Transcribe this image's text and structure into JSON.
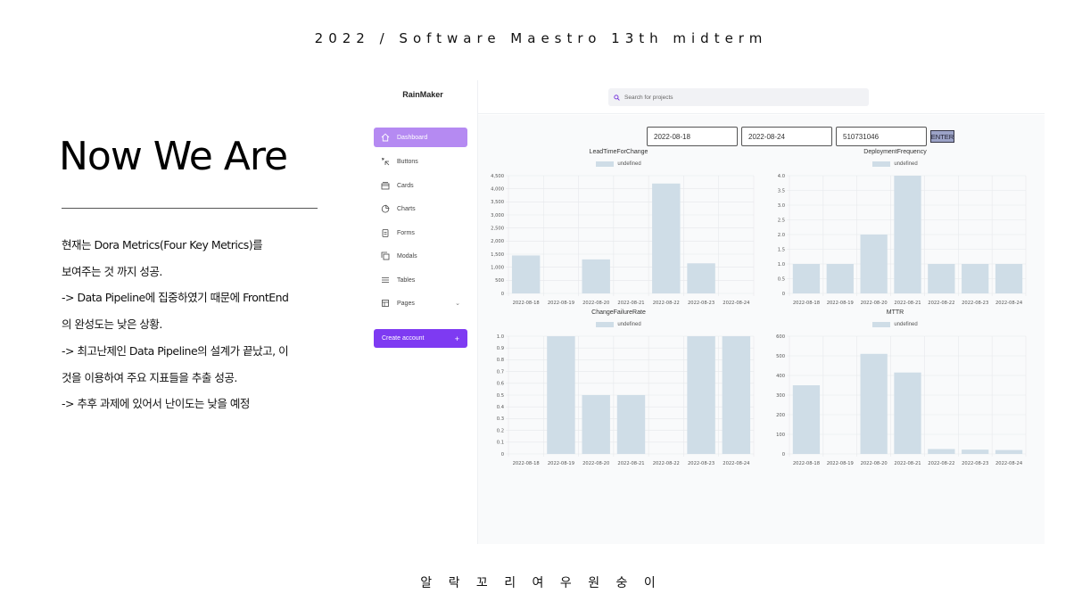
{
  "slide": {
    "header": "2022 / Software Maestro 13th midterm",
    "title": "Now We Are",
    "notes": [
      "현재는 Dora Metrics(Four Key Metrics)를",
      "보여주는 것 까지 성공.",
      "-> Data Pipeline에 집중하였기 때문에 FrontEnd",
      "의 완성도는 낮은 상황.",
      "-> 최고난제인 Data Pipeline의 설계가 끝났고, 이",
      "것을 이용하여 주요 지표들을 추출 성공.",
      "-> 추후 과제에 있어서 난이도는 낮을 예정"
    ],
    "footer": "알 락 꼬 리 여 우 원 숭 이"
  },
  "app": {
    "brand": "RainMaker",
    "search_placeholder": "Search for projects",
    "nav": [
      {
        "label": "Dashboard",
        "icon": "home-icon",
        "active": true
      },
      {
        "label": "Buttons",
        "icon": "cursor-click-icon"
      },
      {
        "label": "Cards",
        "icon": "cards-icon"
      },
      {
        "label": "Charts",
        "icon": "pie-chart-icon"
      },
      {
        "label": "Forms",
        "icon": "clipboard-icon"
      },
      {
        "label": "Modals",
        "icon": "duplicate-icon"
      },
      {
        "label": "Tables",
        "icon": "menu-icon"
      },
      {
        "label": "Pages",
        "icon": "pages-icon",
        "has_chevron": true
      }
    ],
    "create_account": {
      "label": "Create account",
      "icon": "+"
    },
    "filters": {
      "start_date": "2022-08-18",
      "end_date": "2022-08-24",
      "project_id": "510731046",
      "enter_label": "ENTER"
    },
    "accent_color": "#7e3af2",
    "bar_color": "#cfdde7"
  },
  "chart_data": [
    {
      "type": "bar",
      "title": "LeadTimeForChange",
      "legend": "undefined",
      "categories": [
        "2022-08-18",
        "2022-08-19",
        "2022-08-20",
        "2022-08-21",
        "2022-08-22",
        "2022-08-23",
        "2022-08-24"
      ],
      "values": [
        1450,
        0,
        1300,
        0,
        4200,
        1150,
        0
      ],
      "ylim": [
        0,
        4500
      ],
      "yticks": [
        "0",
        "500",
        "1,000",
        "1,500",
        "2,000",
        "2,500",
        "3,000",
        "3,500",
        "4,000",
        "4,500"
      ],
      "grid": true
    },
    {
      "type": "bar",
      "title": "DeploymentFrequency",
      "legend": "undefined",
      "categories": [
        "2022-08-18",
        "2022-08-19",
        "2022-08-20",
        "2022-08-21",
        "2022-08-22",
        "2022-08-23",
        "2022-08-24"
      ],
      "values": [
        1,
        1,
        2,
        4,
        1,
        1,
        1
      ],
      "ylim": [
        0,
        4
      ],
      "yticks": [
        "0",
        "0.5",
        "1.0",
        "1.5",
        "2.0",
        "2.5",
        "3.0",
        "3.5",
        "4.0"
      ],
      "grid": true
    },
    {
      "type": "bar",
      "title": "ChangeFailureRate",
      "legend": "undefined",
      "categories": [
        "2022-08-18",
        "2022-08-19",
        "2022-08-20",
        "2022-08-21",
        "2022-08-22",
        "2022-08-23",
        "2022-08-24"
      ],
      "values": [
        0,
        1,
        0.5,
        0.5,
        0,
        1,
        1
      ],
      "ylim": [
        0,
        1
      ],
      "yticks": [
        "0",
        "0.1",
        "0.2",
        "0.3",
        "0.4",
        "0.5",
        "0.6",
        "0.7",
        "0.8",
        "0.9",
        "1.0"
      ],
      "grid": true
    },
    {
      "type": "bar",
      "title": "MTTR",
      "legend": "undefined",
      "categories": [
        "2022-08-18",
        "2022-08-19",
        "2022-08-20",
        "2022-08-21",
        "2022-08-22",
        "2022-08-23",
        "2022-08-24"
      ],
      "values": [
        350,
        0,
        510,
        415,
        25,
        22,
        20
      ],
      "ylim": [
        0,
        600
      ],
      "yticks": [
        "0",
        "100",
        "200",
        "300",
        "400",
        "500",
        "600"
      ],
      "grid": true
    }
  ]
}
